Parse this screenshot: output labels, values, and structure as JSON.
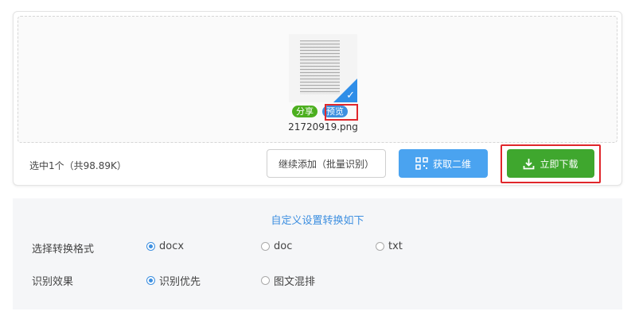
{
  "file": {
    "tags": {
      "share": "分享",
      "preview": "预览"
    },
    "name": "21720919.png"
  },
  "upload": {
    "summary": "选中1个（共98.89K）",
    "add_button": "继续添加（批量识别）",
    "qr_button": "获取二维",
    "download_button": "立即下载"
  },
  "settings": {
    "title": "自定义设置转换如下",
    "format": {
      "label": "选择转换格式",
      "options": [
        "docx",
        "doc",
        "txt"
      ],
      "selected": "docx"
    },
    "effect": {
      "label": "识别效果",
      "options": [
        "识别优先",
        "图文混排"
      ],
      "selected": "识别优先"
    }
  },
  "colors": {
    "accent": "#3d8fe0",
    "download": "#3fa72e",
    "highlight": "#e0262b"
  }
}
